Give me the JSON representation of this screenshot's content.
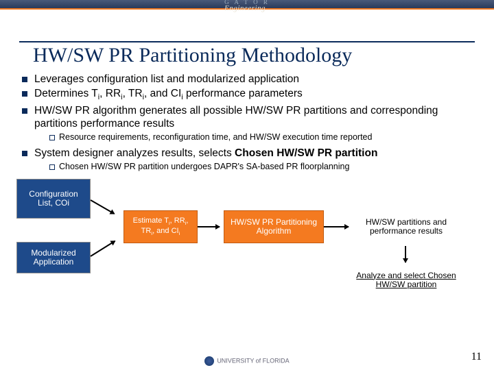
{
  "header": {
    "brand_small": "G A T O R",
    "brand": "Engineering"
  },
  "title": "HW/SW PR Partitioning Methodology",
  "bullets": {
    "b1": "Leverages configuration list and modularized application",
    "b2_pre": "Determines T",
    "b2_mid1": ", RR",
    "b2_mid2": ", TR",
    "b2_mid3": ", and CI",
    "b2_post": " performance parameters",
    "b3": "HW/SW PR algorithm generates all possible HW/SW PR partitions and corresponding partitions performance results",
    "b3_sub": "Resource requirements, reconfiguration time, and HW/SW execution time reported",
    "b4_pre": "System designer analyzes results, selects ",
    "b4_bold": "Chosen HW/SW PR partition",
    "b4_sub": "Chosen HW/SW PR partition undergoes DAPR's SA-based PR floorplanning"
  },
  "diagram": {
    "config": "Configuration List, COi",
    "modapp": "Modularized Application",
    "estimate_l1": "Estimate T",
    "estimate_l2": ", RR",
    "estimate_l3": "TR",
    "estimate_l4": ", and CI",
    "hwsw": "HW/SW PR Partitioning Algorithm",
    "results": "HW/SW partitions and performance results",
    "analyze": "Analyze and select Chosen HW/SW partition"
  },
  "footer": {
    "inst": "UNIVERSITY of FLORIDA",
    "page": "11"
  }
}
